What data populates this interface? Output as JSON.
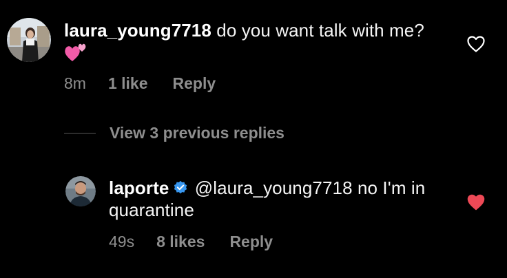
{
  "comments": [
    {
      "username": "laura_young7718",
      "text": " do you want talk with me?",
      "emoji": "two-hearts",
      "time": "8m",
      "likes": "1 like",
      "reply_label": "Reply",
      "liked": false,
      "avatar_icon": "profile-photo"
    },
    {
      "username": "laporte",
      "verified": true,
      "text": " @laura_young7718 no I'm in quarantine",
      "time": "49s",
      "likes": "8 likes",
      "reply_label": "Reply",
      "liked": true,
      "avatar_icon": "profile-photo"
    }
  ],
  "view_replies_label": "View 3 previous replies",
  "colors": {
    "background": "#000000",
    "text": "#f5f5f5",
    "meta": "#8e8e8e",
    "liked_heart": "#ed4956",
    "verified": "#3897f0"
  }
}
